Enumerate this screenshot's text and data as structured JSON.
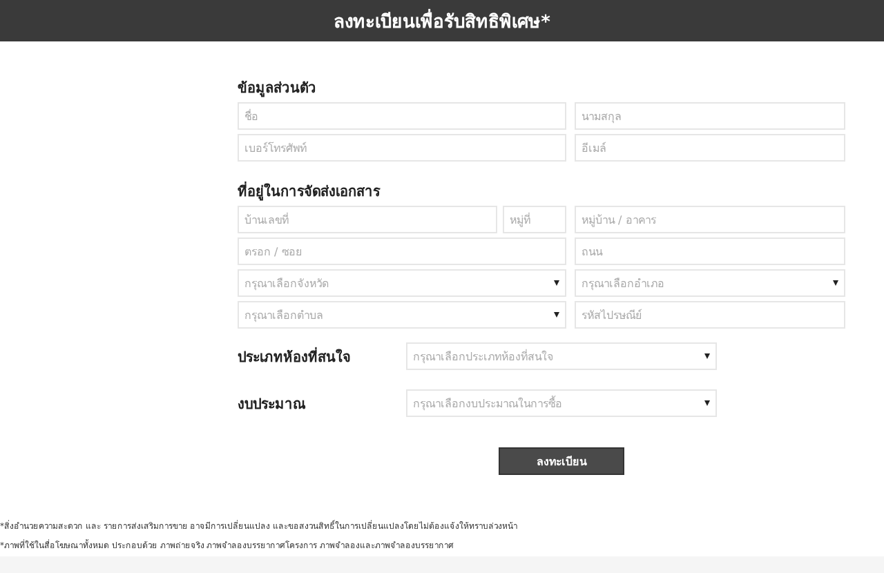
{
  "header": {
    "title": "ลงทะเบียนเพื่อรับสิทธิพิเศษ*"
  },
  "sections": [
    {
      "title": "ข้อมูลส่วนตัว",
      "rows": [
        {
          "left": [
            {
              "kind": "input",
              "placeholder": "ชื่อ"
            }
          ],
          "right": [
            {
              "kind": "input",
              "placeholder": "นามสกุล"
            }
          ]
        },
        {
          "left": [
            {
              "kind": "input",
              "placeholder": "เบอร์โทรศัพท์"
            }
          ],
          "right": [
            {
              "kind": "input",
              "placeholder": "อีเมล์"
            }
          ]
        }
      ]
    },
    {
      "title": "ที่อยู่ในการจัดส่งเอกสาร",
      "rows": [
        {
          "left": [
            {
              "kind": "input",
              "placeholder": "บ้านเลขที่"
            },
            {
              "kind": "input",
              "placeholder": "หมู่ที่"
            }
          ],
          "right": [
            {
              "kind": "input",
              "placeholder": "หมู่บ้าน / อาคาร"
            }
          ]
        },
        {
          "left": [
            {
              "kind": "input",
              "placeholder": "ตรอก / ซอย"
            }
          ],
          "right": [
            {
              "kind": "input",
              "placeholder": "ถนน"
            }
          ]
        },
        {
          "left": [
            {
              "kind": "select",
              "placeholder": "กรุณาเลือกจังหวัด"
            }
          ],
          "right": [
            {
              "kind": "select",
              "placeholder": "กรุณาเลือกอำเภอ"
            }
          ]
        },
        {
          "left": [
            {
              "kind": "select",
              "placeholder": "กรุณาเลือกตำบล"
            }
          ],
          "right": [
            {
              "kind": "input",
              "placeholder": "รหัสไปรษณีย์"
            }
          ]
        }
      ]
    }
  ],
  "choices": [
    {
      "label": "ประเภทห้องที่สนใจ",
      "placeholder": "กรุณาเลือกประเภทห้องที่สนใจ"
    },
    {
      "label": "งบประมาณ",
      "placeholder": "กรุณาเลือกงบประมาณในการซื้อ"
    }
  ],
  "submit": "ลงทะเบียน",
  "footnotes": [
    "*สิ่งอำนวยความสะดวก และ รายการส่งเสริมการขาย อาจมีการเปลี่ยนแปลง และขอสงวนสิทธิ์ในการเปลี่ยนแปลงโดยไม่ต้องแจ้งให้ทราบล่วงหน้า",
    "*ภาพที่ใช้ในสื่อโฆษณาทั้งหมด ประกอบด้วย ภาพถ่ายจริง ภาพจำลองบรรยากาศโครงการ ภาพจำลองและภาพจำลองบรรยากาศ"
  ]
}
